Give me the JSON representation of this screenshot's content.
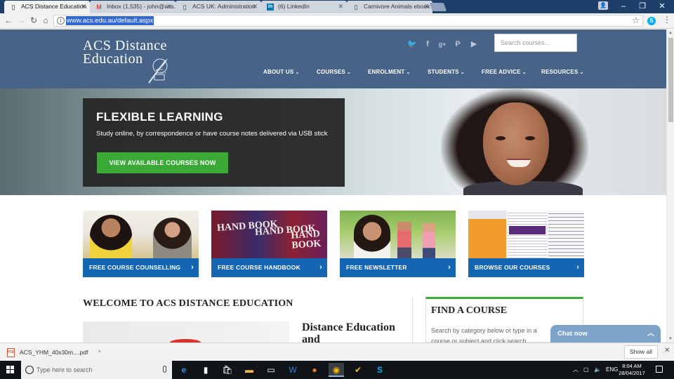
{
  "browser": {
    "tabs": [
      {
        "label": "ACS Distance Education",
        "icon": "page-icon",
        "active": true
      },
      {
        "label": "Inbox (1,535) - john@acs.",
        "icon": "gmail-icon",
        "active": false
      },
      {
        "label": "ACS UK: Administration",
        "icon": "page-icon",
        "active": false
      },
      {
        "label": "(6) LinkedIn",
        "icon": "linkedin-icon",
        "active": false
      },
      {
        "label": "Carnivore Animals ebook",
        "icon": "page-icon",
        "active": false
      }
    ],
    "url": "www.acs.edu.au/default.aspx",
    "window_controls": {
      "minimize": "–",
      "maximize": "❐",
      "close": "✕"
    }
  },
  "site": {
    "logo": {
      "line1": "ACS Distance",
      "line2": "Education",
      "est": "est. 1979"
    },
    "search_placeholder": "Search courses...",
    "nav": [
      {
        "label": "ABOUT US"
      },
      {
        "label": "COURSES"
      },
      {
        "label": "ENROLMENT"
      },
      {
        "label": "STUDENTS"
      },
      {
        "label": "FREE ADVICE"
      },
      {
        "label": "RESOURCES"
      }
    ],
    "hero": {
      "title": "FLEXIBLE LEARNING",
      "subtitle": "Study online, by correspondence or have course notes delivered via USB stick",
      "button": "VIEW AVAILABLE COURSES NOW"
    },
    "tiles": [
      {
        "label": "FREE COURSE COUNSELLING"
      },
      {
        "label": "FREE COURSE HANDBOOK"
      },
      {
        "label": "FREE NEWSLETTER"
      },
      {
        "label": "BROWSE OUR COURSES"
      }
    ],
    "handbook_word": "HAND BOOK",
    "welcome_title": "WELCOME TO ACS DISTANCE EDUCATION",
    "de_heading": "Distance Education and",
    "find_course": {
      "title": "FIND A COURSE",
      "desc": "Search by category below or type in a course or subject and click search"
    },
    "chat": "Chat now"
  },
  "downloads": {
    "file": "ACS_YHM_40x30m....pdf",
    "show_all": "Show all"
  },
  "taskbar": {
    "search_placeholder": "Type here to search",
    "lang": "ENG",
    "time": "8:04 AM",
    "date": "28/04/2017"
  },
  "colors": {
    "header": "#476488",
    "tile_bar": "#1466b5",
    "cta_green": "#3aa935",
    "chat": "#7ea3c9"
  }
}
